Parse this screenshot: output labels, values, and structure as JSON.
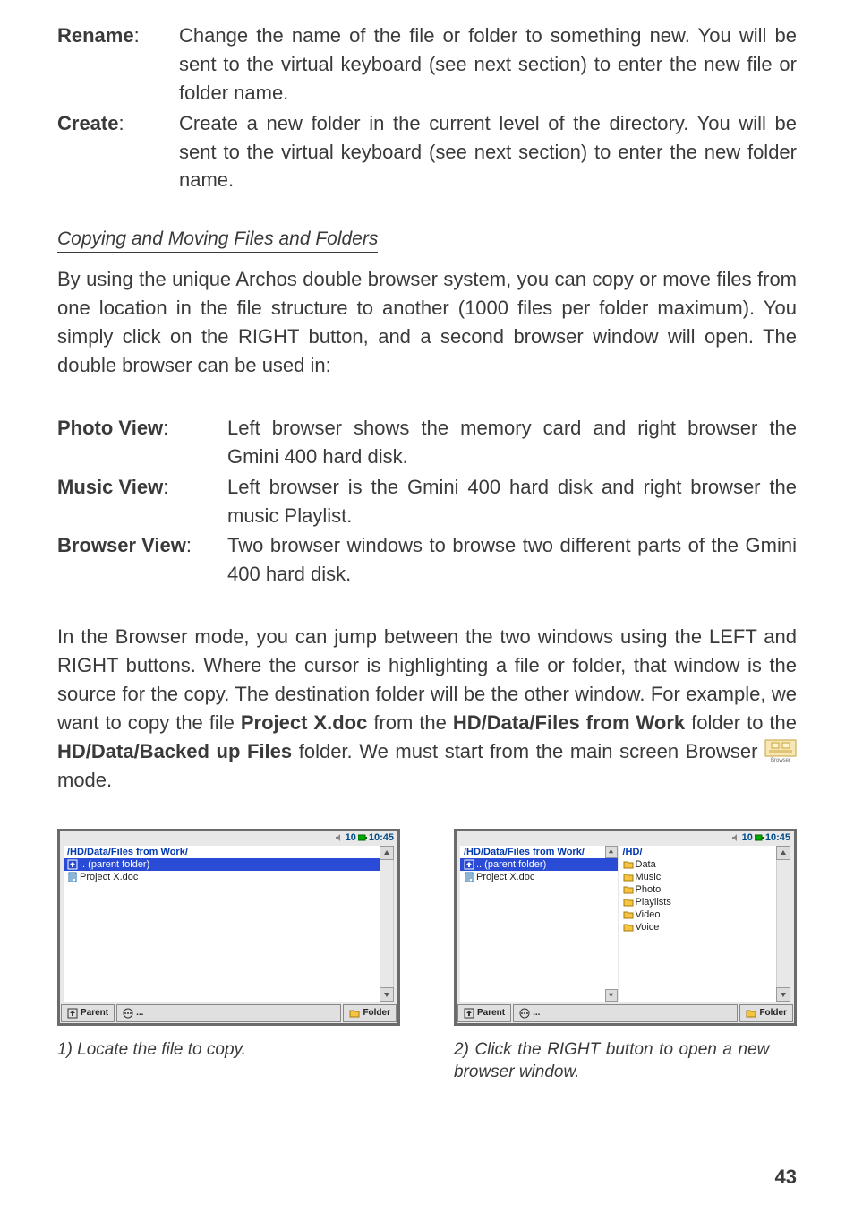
{
  "defs": [
    {
      "term": "Rename",
      "body": "Change the name of the file or folder to something new. You will be sent to the virtual keyboard (see next section) to enter the new file or folder name."
    },
    {
      "term": "Create",
      "body": "Create a new folder in the current level of the directory. You will be sent to the virtual keyboard (see next section) to enter the new folder name."
    }
  ],
  "subhead": "Copying and Moving Files and Folders",
  "para1": "By using the unique Archos double browser system, you can copy or move files from one location in the file structure to another (1000 files per folder maximum). You simply click on the RIGHT button, and a second browser window will open. The double browser can be used in:",
  "views": [
    {
      "term": "Photo View",
      "body": "Left browser shows the memory card and right browser the Gmini 400 hard disk."
    },
    {
      "term": "Music View",
      "body": "Left browser is the Gmini 400 hard disk and right browser the music Playlist."
    },
    {
      "term": "Browser View",
      "body": "Two browser windows to browse two different parts of the Gmini 400 hard disk."
    }
  ],
  "para2_pre": "In the Browser mode, you can jump between the two windows using the LEFT and RIGHT buttons. Where the cursor is highlighting a file or folder, that window is the source for the copy. The destination folder will be the other window. For example, we want to copy the file ",
  "para2_file": "Project X.doc",
  "para2_mid1": " from the ",
  "para2_src": "HD/Data/Files from Work",
  "para2_mid2": " folder to the ",
  "para2_dst": "HD/Data/Backed up Files",
  "para2_mid3": " folder. We must start from the main screen Browser ",
  "para2_tail": " mode.",
  "browser_icon_label": "Browser",
  "screens": {
    "status_time": "10:45",
    "status_batt": "10",
    "left": {
      "path": "/HD/Data/Files from Work/",
      "rows": [
        {
          "icon": "up-folder",
          "label": ".. (parent folder)",
          "sel": true
        },
        {
          "icon": "doc",
          "label": "Project X.doc",
          "sel": false
        }
      ],
      "buttons": {
        "parent": "Parent",
        "more": "...",
        "folder": "Folder"
      },
      "caption": "1) Locate the file to copy."
    },
    "right": {
      "left_pane": {
        "path": "/HD/Data/Files from Work/",
        "rows": [
          {
            "icon": "up-folder",
            "label": ".. (parent folder)",
            "sel": true
          },
          {
            "icon": "doc",
            "label": "Project X.doc",
            "sel": false
          }
        ]
      },
      "right_pane": {
        "path": "/HD/",
        "rows": [
          {
            "icon": "folder",
            "label": "Data",
            "sel": false
          },
          {
            "icon": "folder",
            "label": "Music",
            "sel": false
          },
          {
            "icon": "folder",
            "label": "Photo",
            "sel": false
          },
          {
            "icon": "folder",
            "label": "Playlists",
            "sel": false
          },
          {
            "icon": "folder",
            "label": "Video",
            "sel": false
          },
          {
            "icon": "folder",
            "label": "Voice",
            "sel": false
          }
        ]
      },
      "buttons": {
        "parent": "Parent",
        "more": "...",
        "folder": "Folder"
      },
      "caption": "2) Click the RIGHT button to open a new browser window."
    }
  },
  "pagenum": "43"
}
